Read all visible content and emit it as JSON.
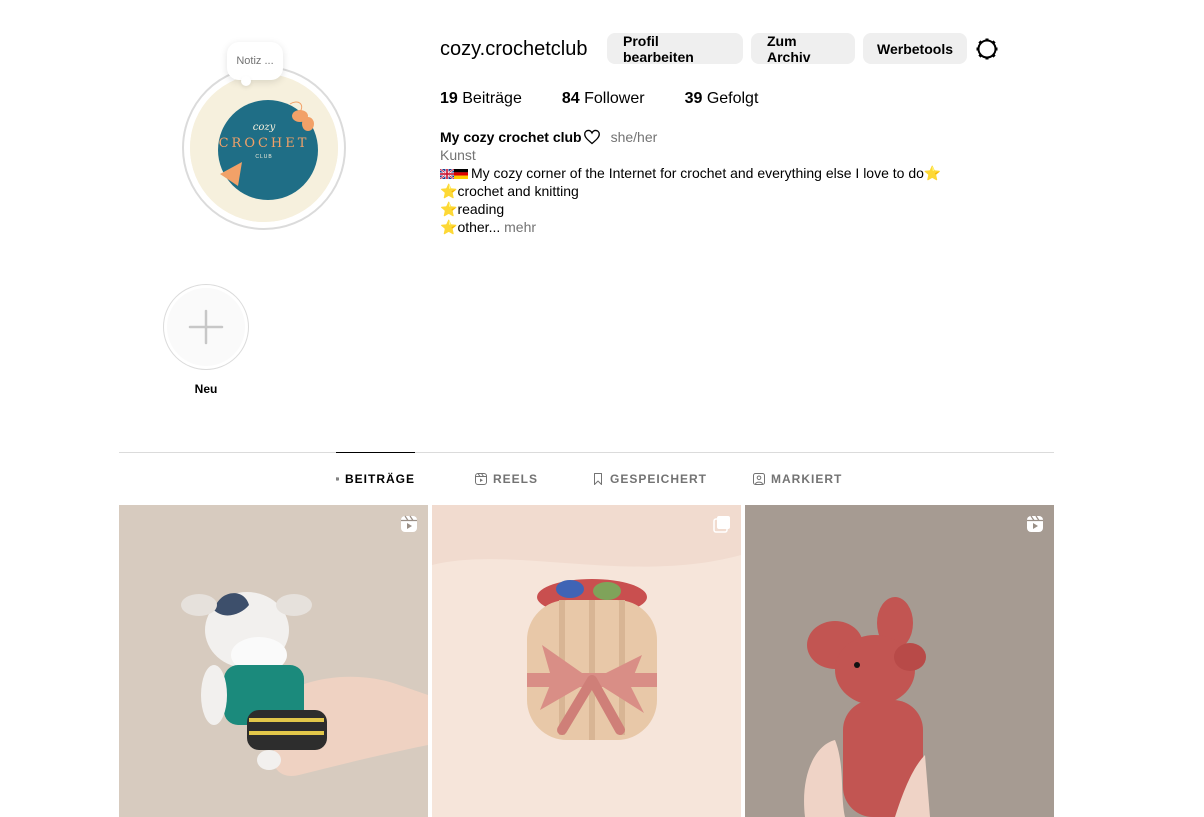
{
  "profile": {
    "username": "cozy.crochetclub",
    "note": "Notiz ...",
    "avatar_logo_top": "cozy",
    "avatar_logo_main": "CROCHET",
    "avatar_logo_sub": "CLUB"
  },
  "actions": {
    "edit_profile": "Profil bearbeiten",
    "archive": "Zum Archiv",
    "ad_tools": "Werbetools"
  },
  "stats": {
    "posts_count": "19",
    "posts_label": "Beiträge",
    "followers_count": "84",
    "followers_label": "Follower",
    "following_count": "39",
    "following_label": "Gefolgt"
  },
  "bio": {
    "name": "My cozy crochet club",
    "pronouns": "she/her",
    "category": "Kunst",
    "line1": "My cozy corner of the Internet for crochet and everything else I love to do",
    "line2": "crochet and knitting",
    "line3": "reading",
    "line4": "other...",
    "more": "mehr"
  },
  "highlights": {
    "new_label": "Neu"
  },
  "tabs": [
    {
      "label": "BEITRÄGE",
      "icon": "grid-icon",
      "active": true
    },
    {
      "label": "REELS",
      "icon": "reels-icon",
      "active": false
    },
    {
      "label": "GESPEICHERT",
      "icon": "bookmark-icon",
      "active": false
    },
    {
      "label": "MARKIERT",
      "icon": "tagged-icon",
      "active": false
    }
  ],
  "posts": [
    {
      "subject": "crochet cow amigurumi",
      "badge": "reel-icon"
    },
    {
      "subject": "crochet gift bundle with ribbon",
      "badge": "carousel-icon"
    },
    {
      "subject": "crochet pink mouse amigurumi",
      "badge": "reel-icon"
    }
  ],
  "colors": {
    "button_bg": "#efefef",
    "muted_text": "#737373",
    "divider": "#dbdbdb",
    "logo_blue": "#1f6e86",
    "logo_orange": "#f2a168"
  }
}
